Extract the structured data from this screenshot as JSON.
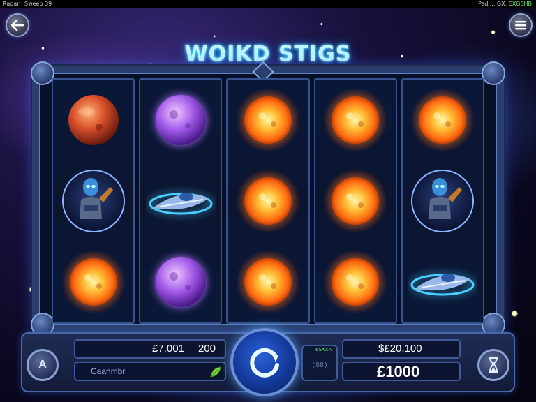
{
  "status_bar": {
    "left_text": "Radar I Sweep 39",
    "right_prefix": "Padl... GX,",
    "right_highlight": "EXG3HB"
  },
  "header": {
    "back_icon": "back-arrow-icon",
    "menu_icon": "hamburger-menu-icon",
    "title": "WOIKD STIGS"
  },
  "reels": [
    {
      "symbols": [
        "red-planet",
        "alien-warrior",
        "fire-sun"
      ]
    },
    {
      "symbols": [
        "purple-planet",
        "spaceship",
        "purple-planet"
      ]
    },
    {
      "symbols": [
        "fire-sun",
        "fire-sun",
        "fire-sun"
      ]
    },
    {
      "symbols": [
        "fire-sun",
        "fire-sun",
        "fire-sun"
      ]
    },
    {
      "symbols": [
        "fire-sun",
        "alien-warrior",
        "spaceship"
      ]
    }
  ],
  "controls": {
    "bet_value": "£7,001",
    "lines_value": "200",
    "label_text": "Caanmbr",
    "balance": "$£20,100",
    "win": "£1000",
    "auto_small": "6SXXA",
    "auto_dim": "(88)",
    "left_button_glyph": "A",
    "spin_icon": "spin-refresh-icon",
    "right_button_icon": "hourglass-icon",
    "leaf_icon": "green-leaf-icon"
  },
  "colors": {
    "title_glow": "#2fd2ff",
    "frame": "#2a3f6e",
    "accent_green": "#5fe86a",
    "spin_blue": "#2a60d8"
  }
}
